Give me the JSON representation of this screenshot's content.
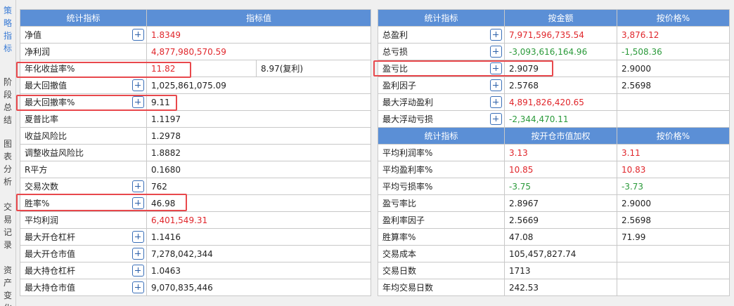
{
  "sidebar": {
    "tabs": [
      {
        "label": "策略指标",
        "active": true
      },
      {
        "label": "阶段总结",
        "active": false
      },
      {
        "label": "图表分析",
        "active": false
      },
      {
        "label": "交易记录",
        "active": false
      },
      {
        "label": "资产变化",
        "active": false
      }
    ]
  },
  "left_table": {
    "headers": [
      "统计指标",
      "指标值"
    ],
    "rows": [
      {
        "name": "净值",
        "value": "1.8349",
        "color": "red",
        "expand": true
      },
      {
        "name": "净利润",
        "value": "4,877,980,570.59",
        "color": "red",
        "expand": false
      },
      {
        "name": "年化收益率%",
        "value": "11.82",
        "value2": "8.97(复利)",
        "color": "red",
        "expand": false
      },
      {
        "name": "最大回撤值",
        "value": "1,025,861,075.09",
        "color": "",
        "expand": true
      },
      {
        "name": "最大回撤率%",
        "value": "9.11",
        "color": "",
        "expand": true
      },
      {
        "name": "夏普比率",
        "value": "1.1197",
        "color": "",
        "expand": false
      },
      {
        "name": "收益风险比",
        "value": "1.2978",
        "color": "",
        "expand": false
      },
      {
        "name": "调整收益风险比",
        "value": "1.8882",
        "color": "",
        "expand": false
      },
      {
        "name": "R平方",
        "value": "0.1680",
        "color": "",
        "expand": false
      },
      {
        "name": "交易次数",
        "value": "762",
        "color": "",
        "expand": true
      },
      {
        "name": "胜率%",
        "value": "46.98",
        "color": "",
        "expand": true
      },
      {
        "name": "平均利润",
        "value": "6,401,549.31",
        "color": "red",
        "expand": false
      },
      {
        "name": "最大开仓杠杆",
        "value": "1.1416",
        "color": "",
        "expand": true
      },
      {
        "name": "最大开仓市值",
        "value": "7,278,042,344",
        "color": "",
        "expand": true
      },
      {
        "name": "最大持仓杠杆",
        "value": "1.0463",
        "color": "",
        "expand": true
      },
      {
        "name": "最大持仓市值",
        "value": "9,070,835,446",
        "color": "",
        "expand": true
      }
    ]
  },
  "right_table": {
    "headers1": [
      "统计指标",
      "按金额",
      "按价格%"
    ],
    "rows1": [
      {
        "name": "总盈利",
        "v1": "7,971,596,735.54",
        "c1": "red",
        "v2": "3,876.12",
        "c2": "red",
        "expand": true
      },
      {
        "name": "总亏损",
        "v1": "-3,093,616,164.96",
        "c1": "green",
        "v2": "-1,508.36",
        "c2": "green",
        "expand": true
      },
      {
        "name": "盈亏比",
        "v1": "2.9079",
        "c1": "",
        "v2": "2.9000",
        "c2": "",
        "expand": true
      },
      {
        "name": "盈利因子",
        "v1": "2.5768",
        "c1": "",
        "v2": "2.5698",
        "c2": "",
        "expand": true
      },
      {
        "name": "最大浮动盈利",
        "v1": "4,891,826,420.65",
        "c1": "red",
        "v2": "",
        "c2": "",
        "expand": true
      },
      {
        "name": "最大浮动亏损",
        "v1": "-2,344,470.11",
        "c1": "green",
        "v2": "",
        "c2": "",
        "expand": true
      }
    ],
    "headers2": [
      "统计指标",
      "按开仓市值加权",
      "按价格%"
    ],
    "rows2": [
      {
        "name": "平均利润率%",
        "v1": "3.13",
        "c1": "red",
        "v2": "3.11",
        "c2": "red"
      },
      {
        "name": "平均盈利率%",
        "v1": "10.85",
        "c1": "red",
        "v2": "10.83",
        "c2": "red"
      },
      {
        "name": "平均亏损率%",
        "v1": "-3.75",
        "c1": "green",
        "v2": "-3.73",
        "c2": "green"
      },
      {
        "name": "盈亏率比",
        "v1": "2.8967",
        "c1": "",
        "v2": "2.9000",
        "c2": ""
      },
      {
        "name": "盈利率因子",
        "v1": "2.5669",
        "c1": "",
        "v2": "2.5698",
        "c2": ""
      },
      {
        "name": "胜算率%",
        "v1": "47.08",
        "c1": "",
        "v2": "71.99",
        "c2": ""
      },
      {
        "name": "交易成本",
        "v1": "105,457,827.74",
        "c1": "",
        "v2": "",
        "c2": ""
      },
      {
        "name": "交易日数",
        "v1": "1713",
        "c1": "",
        "v2": "",
        "c2": ""
      },
      {
        "name": "年均交易日数",
        "v1": "242.53",
        "c1": "",
        "v2": "",
        "c2": ""
      }
    ]
  },
  "colors": {
    "accent": "#5b8fd6",
    "positive": "#e0262b",
    "negative": "#2a9a3a",
    "highlight": "#e8484c"
  }
}
